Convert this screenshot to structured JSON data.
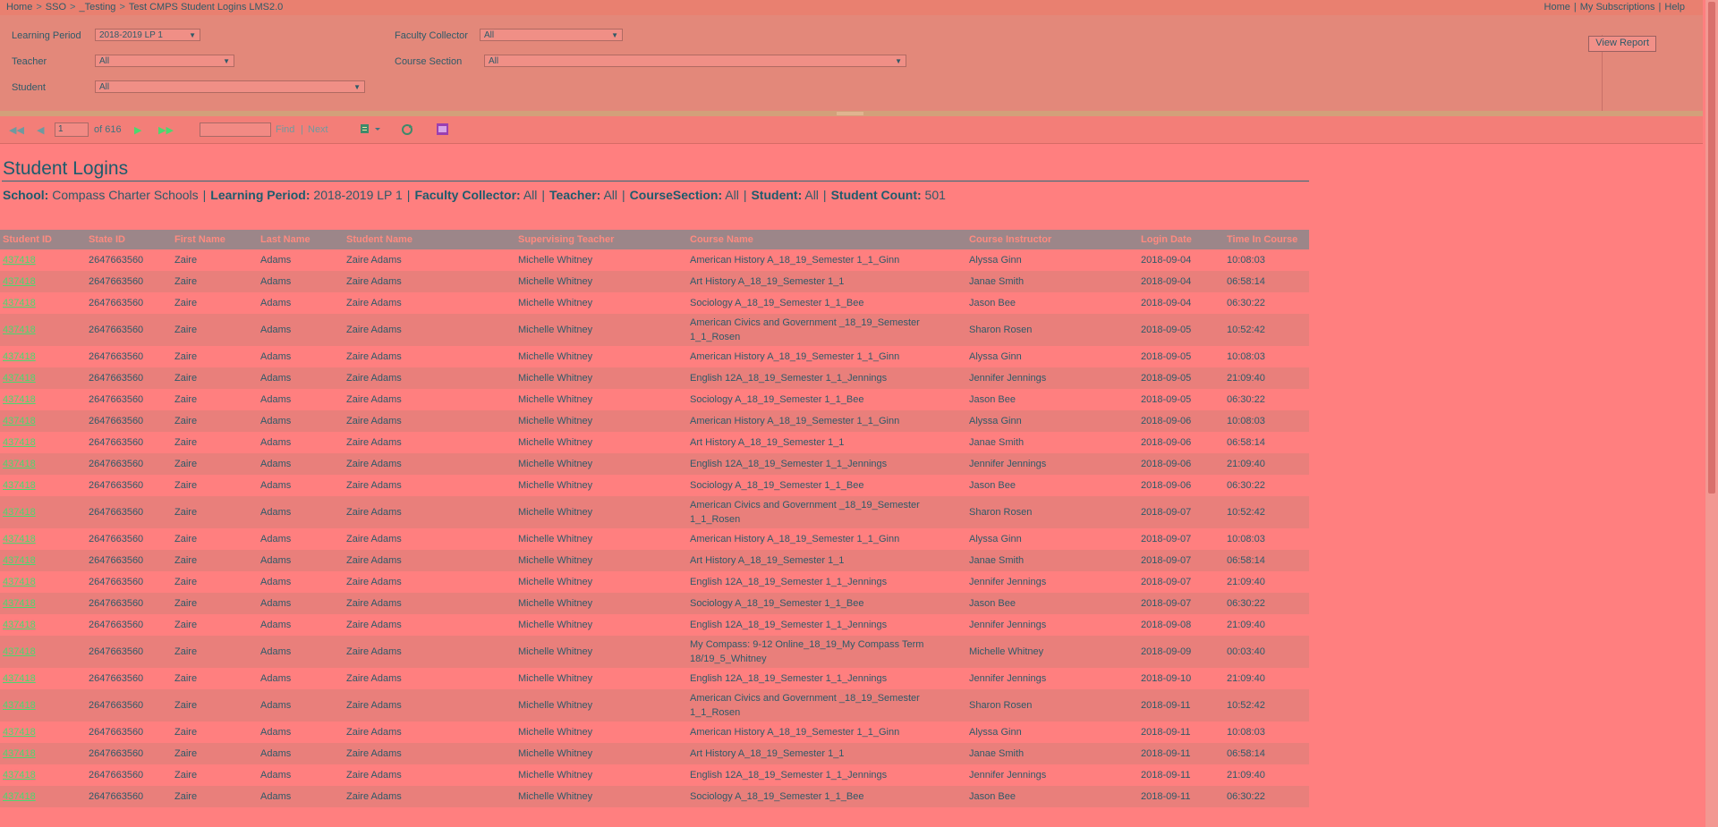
{
  "breadcrumb": [
    "Home",
    "SSO",
    "_Testing",
    "Test CMPS Student Logins LMS2.0"
  ],
  "top_links": [
    "Home",
    "My Subscriptions",
    "Help"
  ],
  "params": {
    "learning_period": {
      "label": "Learning Period",
      "value": "2018-2019 LP 1"
    },
    "faculty_collector": {
      "label": "Faculty Collector",
      "value": "All"
    },
    "teacher": {
      "label": "Teacher",
      "value": "All"
    },
    "course_section": {
      "label": "Course Section",
      "value": "All"
    },
    "student": {
      "label": "Student",
      "value": "All"
    },
    "view_report": "View Report"
  },
  "toolbar": {
    "page": "1",
    "of_label": "of 616",
    "find": "Find",
    "next": "Next",
    "sep": "|"
  },
  "report": {
    "title": "Student Logins",
    "filters": [
      {
        "label": "School:",
        "value": "Compass Charter Schools"
      },
      {
        "label": "Learning Period:",
        "value": "2018-2019 LP 1"
      },
      {
        "label": "Faculty Collector:",
        "value": "All"
      },
      {
        "label": "Teacher:",
        "value": "All"
      },
      {
        "label": "CourseSection:",
        "value": "All"
      },
      {
        "label": "Student:",
        "value": "All"
      },
      {
        "label": "Student Count:",
        "value": "501"
      }
    ],
    "columns": [
      "Student ID",
      "State ID",
      "First Name",
      "Last Name",
      "Student Name",
      "Supervising Teacher",
      "Course Name",
      "Course Instructor",
      "Login Date",
      "Time In Course"
    ],
    "rows": [
      [
        "437418",
        "2647663560",
        "Zaire",
        "Adams",
        "Zaire Adams",
        "Michelle Whitney",
        "American History A_18_19_Semester 1_1_Ginn",
        "Alyssa Ginn",
        "2018-09-04",
        "10:08:03"
      ],
      [
        "437418",
        "2647663560",
        "Zaire",
        "Adams",
        "Zaire Adams",
        "Michelle Whitney",
        "Art History A_18_19_Semester 1_1",
        "Janae Smith",
        "2018-09-04",
        "06:58:14"
      ],
      [
        "437418",
        "2647663560",
        "Zaire",
        "Adams",
        "Zaire Adams",
        "Michelle Whitney",
        "Sociology A_18_19_Semester 1_1_Bee",
        "Jason Bee",
        "2018-09-04",
        "06:30:22"
      ],
      [
        "437418",
        "2647663560",
        "Zaire",
        "Adams",
        "Zaire Adams",
        "Michelle Whitney",
        "American Civics and Government _18_19_Semester 1_1_Rosen",
        "Sharon Rosen",
        "2018-09-05",
        "10:52:42"
      ],
      [
        "437418",
        "2647663560",
        "Zaire",
        "Adams",
        "Zaire Adams",
        "Michelle Whitney",
        "American History A_18_19_Semester 1_1_Ginn",
        "Alyssa Ginn",
        "2018-09-05",
        "10:08:03"
      ],
      [
        "437418",
        "2647663560",
        "Zaire",
        "Adams",
        "Zaire Adams",
        "Michelle Whitney",
        "English 12A_18_19_Semester 1_1_Jennings",
        "Jennifer Jennings",
        "2018-09-05",
        "21:09:40"
      ],
      [
        "437418",
        "2647663560",
        "Zaire",
        "Adams",
        "Zaire Adams",
        "Michelle Whitney",
        "Sociology A_18_19_Semester 1_1_Bee",
        "Jason Bee",
        "2018-09-05",
        "06:30:22"
      ],
      [
        "437418",
        "2647663560",
        "Zaire",
        "Adams",
        "Zaire Adams",
        "Michelle Whitney",
        "American History A_18_19_Semester 1_1_Ginn",
        "Alyssa Ginn",
        "2018-09-06",
        "10:08:03"
      ],
      [
        "437418",
        "2647663560",
        "Zaire",
        "Adams",
        "Zaire Adams",
        "Michelle Whitney",
        "Art History A_18_19_Semester 1_1",
        "Janae Smith",
        "2018-09-06",
        "06:58:14"
      ],
      [
        "437418",
        "2647663560",
        "Zaire",
        "Adams",
        "Zaire Adams",
        "Michelle Whitney",
        "English 12A_18_19_Semester 1_1_Jennings",
        "Jennifer Jennings",
        "2018-09-06",
        "21:09:40"
      ],
      [
        "437418",
        "2647663560",
        "Zaire",
        "Adams",
        "Zaire Adams",
        "Michelle Whitney",
        "Sociology A_18_19_Semester 1_1_Bee",
        "Jason Bee",
        "2018-09-06",
        "06:30:22"
      ],
      [
        "437418",
        "2647663560",
        "Zaire",
        "Adams",
        "Zaire Adams",
        "Michelle Whitney",
        "American Civics and Government _18_19_Semester 1_1_Rosen",
        "Sharon Rosen",
        "2018-09-07",
        "10:52:42"
      ],
      [
        "437418",
        "2647663560",
        "Zaire",
        "Adams",
        "Zaire Adams",
        "Michelle Whitney",
        "American History A_18_19_Semester 1_1_Ginn",
        "Alyssa Ginn",
        "2018-09-07",
        "10:08:03"
      ],
      [
        "437418",
        "2647663560",
        "Zaire",
        "Adams",
        "Zaire Adams",
        "Michelle Whitney",
        "Art History A_18_19_Semester 1_1",
        "Janae Smith",
        "2018-09-07",
        "06:58:14"
      ],
      [
        "437418",
        "2647663560",
        "Zaire",
        "Adams",
        "Zaire Adams",
        "Michelle Whitney",
        "English 12A_18_19_Semester 1_1_Jennings",
        "Jennifer Jennings",
        "2018-09-07",
        "21:09:40"
      ],
      [
        "437418",
        "2647663560",
        "Zaire",
        "Adams",
        "Zaire Adams",
        "Michelle Whitney",
        "Sociology A_18_19_Semester 1_1_Bee",
        "Jason Bee",
        "2018-09-07",
        "06:30:22"
      ],
      [
        "437418",
        "2647663560",
        "Zaire",
        "Adams",
        "Zaire Adams",
        "Michelle Whitney",
        "English 12A_18_19_Semester 1_1_Jennings",
        "Jennifer Jennings",
        "2018-09-08",
        "21:09:40"
      ],
      [
        "437418",
        "2647663560",
        "Zaire",
        "Adams",
        "Zaire Adams",
        "Michelle Whitney",
        "My Compass: 9-12 Online_18_19_My Compass Term 18/19_5_Whitney",
        "Michelle Whitney",
        "2018-09-09",
        "00:03:40"
      ],
      [
        "437418",
        "2647663560",
        "Zaire",
        "Adams",
        "Zaire Adams",
        "Michelle Whitney",
        "English 12A_18_19_Semester 1_1_Jennings",
        "Jennifer Jennings",
        "2018-09-10",
        "21:09:40"
      ],
      [
        "437418",
        "2647663560",
        "Zaire",
        "Adams",
        "Zaire Adams",
        "Michelle Whitney",
        "American Civics and Government _18_19_Semester 1_1_Rosen",
        "Sharon Rosen",
        "2018-09-11",
        "10:52:42"
      ],
      [
        "437418",
        "2647663560",
        "Zaire",
        "Adams",
        "Zaire Adams",
        "Michelle Whitney",
        "American History A_18_19_Semester 1_1_Ginn",
        "Alyssa Ginn",
        "2018-09-11",
        "10:08:03"
      ],
      [
        "437418",
        "2647663560",
        "Zaire",
        "Adams",
        "Zaire Adams",
        "Michelle Whitney",
        "Art History A_18_19_Semester 1_1",
        "Janae Smith",
        "2018-09-11",
        "06:58:14"
      ],
      [
        "437418",
        "2647663560",
        "Zaire",
        "Adams",
        "Zaire Adams",
        "Michelle Whitney",
        "English 12A_18_19_Semester 1_1_Jennings",
        "Jennifer Jennings",
        "2018-09-11",
        "21:09:40"
      ],
      [
        "437418",
        "2647663560",
        "Zaire",
        "Adams",
        "Zaire Adams",
        "Michelle Whitney",
        "Sociology A_18_19_Semester 1_1_Bee",
        "Jason Bee",
        "2018-09-11",
        "06:30:22"
      ]
    ]
  },
  "icons": {
    "first": "first-page-icon",
    "prev": "previous-page-icon",
    "next": "next-page-icon",
    "last": "last-page-icon",
    "export": "export-icon",
    "refresh": "refresh-icon",
    "print": "print-icon",
    "dropdown": "chevron-down-icon"
  },
  "colors": {
    "background": "#ff7f7f",
    "header_row": "#9c8689",
    "link": "#4bd86f"
  }
}
